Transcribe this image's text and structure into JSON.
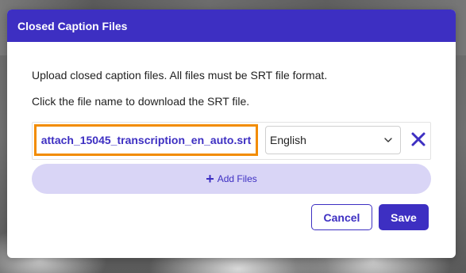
{
  "modal": {
    "title": "Closed Caption Files",
    "instruction_upload": "Upload closed caption files. All files must be SRT file format.",
    "instruction_download": "Click the file name to download the SRT file."
  },
  "files": [
    {
      "name": "attach_15045_transcription_en_auto.srt",
      "language": "English",
      "remove_icon": "close-icon"
    }
  ],
  "add_files": {
    "label": "Add Files",
    "icon": "plus-icon"
  },
  "actions": {
    "cancel_label": "Cancel",
    "save_label": "Save"
  },
  "colors": {
    "accent": "#3d2fc2",
    "highlight": "#f28c00",
    "add_files_bg": "#d9d5f6"
  }
}
